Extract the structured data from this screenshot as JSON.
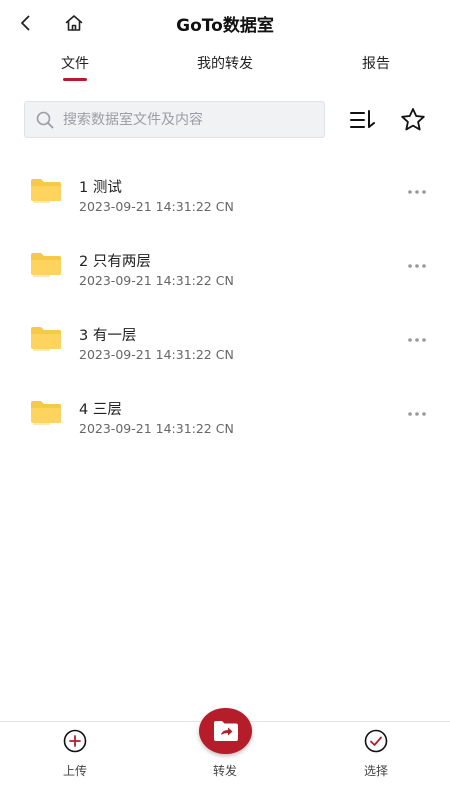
{
  "header": {
    "title": "GoTo数据室"
  },
  "tabs": [
    {
      "label": "文件",
      "active": true
    },
    {
      "label": "我的转发",
      "active": false
    },
    {
      "label": "报告",
      "active": false
    }
  ],
  "search": {
    "placeholder": "搜索数据室文件及内容"
  },
  "files": [
    {
      "name": "1 测试",
      "date": "2023-09-21 14:31:22 CN"
    },
    {
      "name": "2 只有两层",
      "date": "2023-09-21 14:31:22 CN"
    },
    {
      "name": "3 有一层",
      "date": "2023-09-21 14:31:22 CN"
    },
    {
      "name": "4 三层",
      "date": "2023-09-21 14:31:22 CN"
    }
  ],
  "bottom_bar": {
    "upload_label": "上传",
    "forward_label": "转发",
    "select_label": "选择"
  },
  "colors": {
    "accent": "#b61d2b",
    "folder": "#f7c948"
  }
}
